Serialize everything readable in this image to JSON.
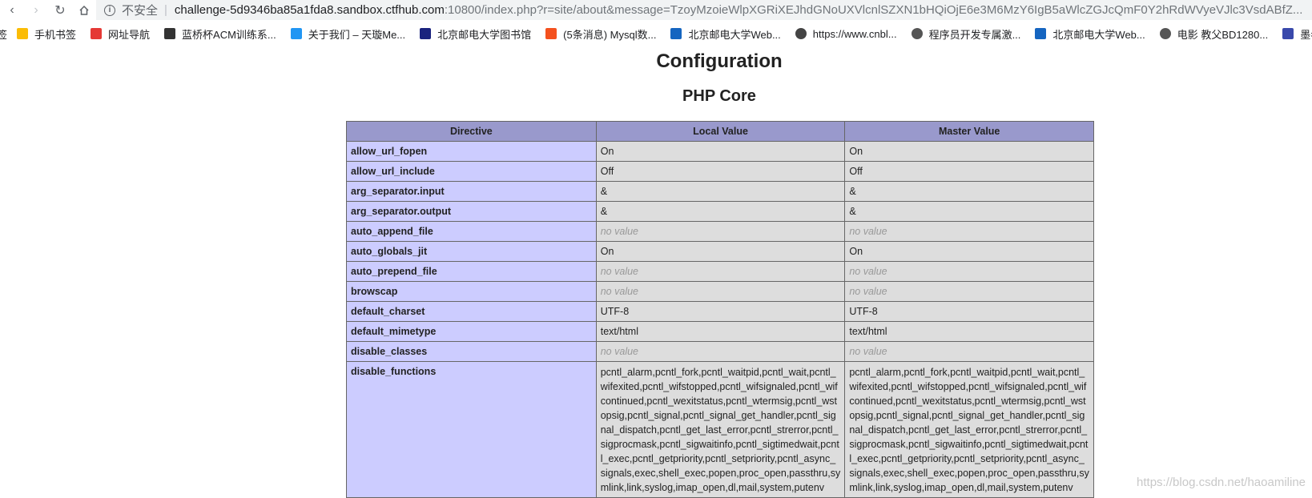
{
  "browser": {
    "insecure_label": "不安全",
    "url_host": "challenge-5d9346ba85a1fda8.sandbox.ctfhub.com",
    "url_rest": ":10800/index.php?r=site/about&message=TzoyMzoieWlpXGRiXEJhdGNoUXVlcnlSZXN1bHQiOjE6e3M6MzY6IgB5aWlcZGJcQmF0Y2hRdWVyeVJlc3VsdABfZ..."
  },
  "bookmarks": [
    {
      "label": "签",
      "icon": "none",
      "color": "#ffffff"
    },
    {
      "label": "手机书签",
      "icon": "bookmark-mobile-icon",
      "color": "#fbbc05"
    },
    {
      "label": "网址导航",
      "icon": "site-nav-icon",
      "color": "#e53935"
    },
    {
      "label": "蓝桥杯ACM训练系...",
      "icon": "lanqiao-icon",
      "color": "#333333"
    },
    {
      "label": "关于我们 – 天璇Me...",
      "icon": "star-burst-icon",
      "color": "#2196f3"
    },
    {
      "label": "北京邮电大学图书馆",
      "icon": "library-icon",
      "color": "#1a237e"
    },
    {
      "label": "(5条消息) Mysql数...",
      "icon": "csdn-icon",
      "color": "#f4511e"
    },
    {
      "label": "北京邮电大学Web...",
      "icon": "bupt-icon",
      "color": "#1565c0"
    },
    {
      "label": "https://www.cnbl...",
      "icon": "cnblogs-icon",
      "color": "#444444"
    },
    {
      "label": "程序员开发专属激...",
      "icon": "globe-icon",
      "color": "#555555"
    },
    {
      "label": "北京邮电大学Web...",
      "icon": "bupt-icon",
      "color": "#1565c0"
    },
    {
      "label": "电影 教父BD1280...",
      "icon": "globe-icon",
      "color": "#555555"
    },
    {
      "label": "墨者学院 勤",
      "icon": "mozhe-icon",
      "color": "#3949ab"
    }
  ],
  "page": {
    "title": "Configuration",
    "section": "PHP Core"
  },
  "table": {
    "headers": [
      "Directive",
      "Local Value",
      "Master Value"
    ],
    "no_value": "no value",
    "rows": [
      {
        "directive": "allow_url_fopen",
        "local": "On",
        "master": "On"
      },
      {
        "directive": "allow_url_include",
        "local": "Off",
        "master": "Off"
      },
      {
        "directive": "arg_separator.input",
        "local": "&",
        "master": "&"
      },
      {
        "directive": "arg_separator.output",
        "local": "&",
        "master": "&"
      },
      {
        "directive": "auto_append_file",
        "local": null,
        "master": null
      },
      {
        "directive": "auto_globals_jit",
        "local": "On",
        "master": "On"
      },
      {
        "directive": "auto_prepend_file",
        "local": null,
        "master": null
      },
      {
        "directive": "browscap",
        "local": null,
        "master": null
      },
      {
        "directive": "default_charset",
        "local": "UTF-8",
        "master": "UTF-8"
      },
      {
        "directive": "default_mimetype",
        "local": "text/html",
        "master": "text/html"
      },
      {
        "directive": "disable_classes",
        "local": null,
        "master": null
      },
      {
        "directive": "disable_functions",
        "local": "pcntl_alarm,pcntl_fork,pcntl_waitpid,pcntl_wait,pcntl_wifexited,pcntl_wifstopped,pcntl_wifsignaled,pcntl_wifcontinued,pcntl_wexitstatus,pcntl_wtermsig,pcntl_wstopsig,pcntl_signal,pcntl_signal_get_handler,pcntl_signal_dispatch,pcntl_get_last_error,pcntl_strerror,pcntl_sigprocmask,pcntl_sigwaitinfo,pcntl_sigtimedwait,pcntl_exec,pcntl_getpriority,pcntl_setpriority,pcntl_async_signals,exec,shell_exec,popen,proc_open,passthru,symlink,link,syslog,imap_open,dl,mail,system,putenv",
        "master": "pcntl_alarm,pcntl_fork,pcntl_waitpid,pcntl_wait,pcntl_wifexited,pcntl_wifstopped,pcntl_wifsignaled,pcntl_wifcontinued,pcntl_wexitstatus,pcntl_wtermsig,pcntl_wstopsig,pcntl_signal,pcntl_signal_get_handler,pcntl_signal_dispatch,pcntl_get_last_error,pcntl_strerror,pcntl_sigprocmask,pcntl_sigwaitinfo,pcntl_sigtimedwait,pcntl_exec,pcntl_getpriority,pcntl_setpriority,pcntl_async_signals,exec,shell_exec,popen,proc_open,passthru,symlink,link,syslog,imap_open,dl,mail,system,putenv"
      }
    ]
  },
  "watermark": "https://blog.csdn.net/haoamiline"
}
